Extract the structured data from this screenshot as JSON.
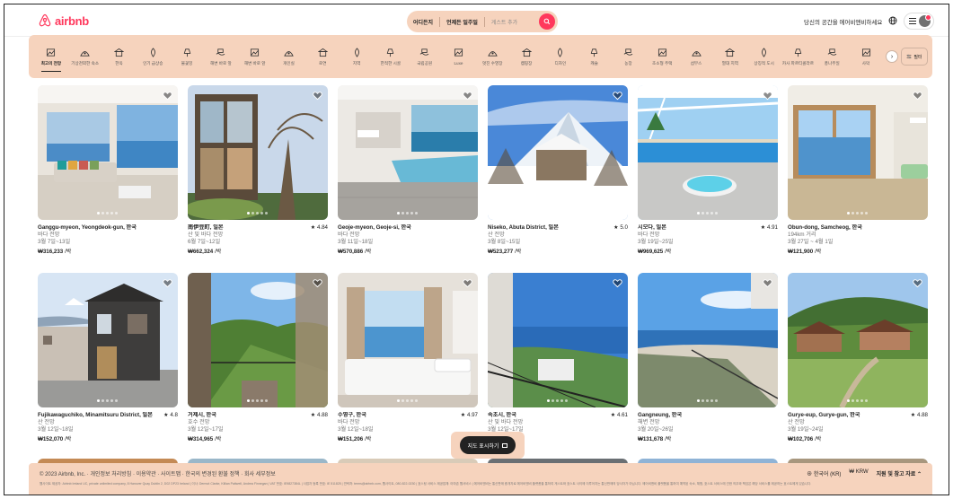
{
  "header": {
    "logo_text": "airbnb",
    "brand_color": "#ff385c",
    "search": {
      "where": "어디든지",
      "when": "언제든 일주일",
      "guests": "게스트 추가"
    },
    "host_link": "당신의 공간을 에어비앤비하세요"
  },
  "categories": [
    {
      "label": "최고의 전망",
      "icon": "view-icon",
      "active": true
    },
    {
      "label": "기상천외한 숙소",
      "icon": "omg-icon"
    },
    {
      "label": "한옥",
      "icon": "hanok-icon"
    },
    {
      "label": "인기 급상승",
      "icon": "trending-icon"
    },
    {
      "label": "불꽃잉",
      "icon": "lamp-icon"
    },
    {
      "label": "해변 바로 앞",
      "icon": "beachfront-icon"
    },
    {
      "label": "해변 바로 앞",
      "icon": "beach-icon"
    },
    {
      "label": "개인실",
      "icon": "room-icon"
    },
    {
      "label": "로연",
      "icon": "cabin-icon"
    },
    {
      "label": "지역",
      "icon": "map-icon"
    },
    {
      "label": "한적한 시골",
      "icon": "countryside-icon"
    },
    {
      "label": "국립공원",
      "icon": "park-icon"
    },
    {
      "label": "Luxe",
      "icon": "luxe-icon"
    },
    {
      "label": "멋진 수영장",
      "icon": "pool-icon"
    },
    {
      "label": "캠핑장",
      "icon": "camping-icon"
    },
    {
      "label": "디자인",
      "icon": "design-icon"
    },
    {
      "label": "캐슬",
      "icon": "castle-icon"
    },
    {
      "label": "농장",
      "icon": "farm-icon"
    },
    {
      "label": "초소형 주택",
      "icon": "tiny-home-icon"
    },
    {
      "label": "섬무스",
      "icon": "island-icon"
    },
    {
      "label": "열대 지역",
      "icon": "tropical-icon"
    },
    {
      "label": "상징적 도시",
      "icon": "city-icon"
    },
    {
      "label": "카사 파르티콜라르",
      "icon": "casa-icon"
    },
    {
      "label": "풍나주일",
      "icon": "windmill-icon"
    },
    {
      "label": "사막",
      "icon": "desert-icon"
    }
  ],
  "filter_label": "필터",
  "listings": [
    {
      "title": "Ganggu-myeon, Yeongdeok-gun, 한국",
      "rating": "",
      "line2": "바다 전망",
      "line3": "3월 7일~13일",
      "price": "₩316,233",
      "per": " /박"
    },
    {
      "title": "南伊豆町, 일본",
      "rating": "★ 4.84",
      "line2": "산 및 바다 전망",
      "line3": "6월 7일~12일",
      "price": "₩662,324",
      "per": " /박"
    },
    {
      "title": "Geoje-myeon, Geoje-si, 한국",
      "rating": "",
      "line2": "바다 전망",
      "line3": "3월 11일~18일",
      "price": "₩570,886",
      "per": " /박"
    },
    {
      "title": "Niseko, Abuta District, 일본",
      "rating": "★ 5.0",
      "line2": "산 전망",
      "line3": "3월 8일~15일",
      "price": "₩523,277",
      "per": " /박"
    },
    {
      "title": "시모다, 일본",
      "rating": "★ 4.91",
      "line2": "바다 전망",
      "line3": "3월 19일~25일",
      "price": "₩969,625",
      "per": " /박"
    },
    {
      "title": "Obun-dong, Samcheog, 한국",
      "rating": "",
      "line2": "194km 거리",
      "line3": "3월 27일 ~ 4월 1일",
      "price": "₩121,900",
      "per": " /박"
    },
    {
      "title": "Fujikawaguchiko, Minamitsuru District, 일본",
      "rating": "★ 4.8",
      "line2": "산 전망",
      "line3": "3월 12일~18일",
      "price": "₩152,070",
      "per": " /박"
    },
    {
      "title": "거제시, 한국",
      "rating": "★ 4.88",
      "line2": "호수 전망",
      "line3": "3월 12일~17일",
      "price": "₩314,965",
      "per": " /박"
    },
    {
      "title": "수영구, 한국",
      "rating": "★ 4.97",
      "line2": "바다 전망",
      "line3": "3월 12일~18일",
      "price": "₩151,206",
      "per": " /박"
    },
    {
      "title": "속초시, 한국",
      "rating": "★ 4.61",
      "line2": "산 및 바다 전망",
      "line3": "3월 12일~17일",
      "price": "",
      "per": ""
    },
    {
      "title": "Gangneung, 한국",
      "rating": "",
      "line2": "해변 전망",
      "line3": "3월 20일~26일",
      "price": "₩131,678",
      "per": " /박"
    },
    {
      "title": "Gurye-eup, Gurye-gun, 한국",
      "rating": "★ 4.88",
      "line2": "산 전망",
      "line3": "3월 19일~24일",
      "price": "₩102,706",
      "per": " /박"
    }
  ],
  "map_button": "지도 표시하기",
  "footer": {
    "line1": "© 2023 Airbnb, Inc. · 개인정보 처리방침 · 이용약관 · 사이트맵 · 한국의 변경된 환불 정책 · 회사 세부정보",
    "line2": "웹사이트 제공자: Airbnb Ireland UC, private unlimited company, 8 Hanover Quay Dublin 2, D02 DP23 Ireland | 이사: Dermot Clarke, Killian Pattwell, Andrea Finnegan | VAT 번호: IE9827384L | 사업자 등록 번호: IE 511825 | 연락처: terms@airbnb.com, 웹사이트, 080-822-0230 | 호스팅 서비스 제공업체: 아마존 웹서비스 | 에어비앤비는 통신판매 중개자로 에어비앤비 플랫폼을 통하여 게스트와 호스트 사이에 이루어지는 통신판매의 당사자가 아닙니다. 에어비앤비 플랫폼을 통하여 예약된 숙소, 체험, 호스트 서비스에 관한 의무와 책임은 해당 서비스를 제공하는 호스트에게 있습니다.",
    "language": "한국어 (KR)",
    "currency": "₩ KRW",
    "support": "지원 및 참고 자료"
  }
}
